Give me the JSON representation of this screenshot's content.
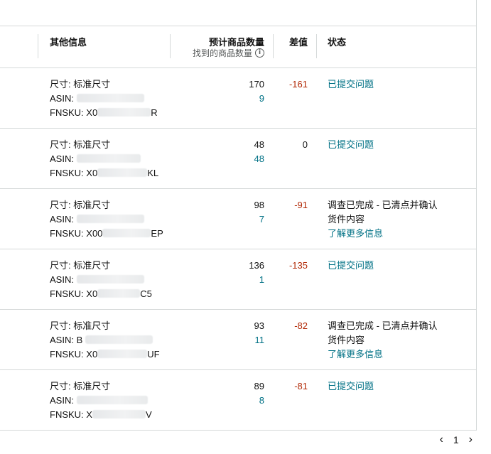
{
  "header": {
    "other_info": "其他信息",
    "expected_qty": "预计商品数量",
    "found_qty": "找到的商品数量",
    "diff": "差值",
    "status": "状态"
  },
  "rows": [
    {
      "size": "尺寸: 标准尺寸",
      "asin_label": "ASIN:",
      "asin_tail": "",
      "fnsku_label": "FNSKU: X0",
      "fnsku_tail": "R",
      "expected": "170",
      "found": "9",
      "diff": "-161",
      "status": "已提交问题",
      "status_type": "link",
      "status_line2": "",
      "more": ""
    },
    {
      "size": "尺寸: 标准尺寸",
      "asin_label": "ASIN:",
      "asin_tail": "",
      "fnsku_label": "FNSKU: X0",
      "fnsku_tail": "KL",
      "expected": "48",
      "found": "48",
      "diff": "0",
      "status": "已提交问题",
      "status_type": "link",
      "status_line2": "",
      "more": ""
    },
    {
      "size": "尺寸: 标准尺寸",
      "asin_label": "ASIN:",
      "asin_tail": "",
      "fnsku_label": "FNSKU: X00",
      "fnsku_tail": "EP",
      "expected": "98",
      "found": "7",
      "diff": "-91",
      "status": "调查已完成 - 已清点并确认",
      "status_type": "text",
      "status_line2": "货件内容",
      "more": "了解更多信息"
    },
    {
      "size": "尺寸: 标准尺寸",
      "asin_label": "ASIN:",
      "asin_tail": "",
      "fnsku_label": "FNSKU: X0",
      "fnsku_tail": "C5",
      "expected": "136",
      "found": "1",
      "diff": "-135",
      "status": "已提交问题",
      "status_type": "link",
      "status_line2": "",
      "more": ""
    },
    {
      "size": "尺寸: 标准尺寸",
      "asin_label": "ASIN: B",
      "asin_tail": "",
      "fnsku_label": "FNSKU: X0",
      "fnsku_tail": "UF",
      "expected": "93",
      "found": "11",
      "diff": "-82",
      "status": "调查已完成 - 已清点并确认",
      "status_type": "text",
      "status_line2": "货件内容",
      "more": "了解更多信息"
    },
    {
      "size": "尺寸: 标准尺寸",
      "asin_label": "ASIN:",
      "asin_tail": "",
      "fnsku_label": "FNSKU: X",
      "fnsku_tail": "V",
      "expected": "89",
      "found": "8",
      "diff": "-81",
      "status": "已提交问题",
      "status_type": "link",
      "status_line2": "",
      "more": ""
    }
  ],
  "pagination": {
    "prev_icon": "chevron-left-icon",
    "current_page": "1",
    "next_icon": "chevron-right-icon"
  },
  "colors": {
    "link": "#007185",
    "negative": "#b12704",
    "border": "#d5d9d9"
  }
}
